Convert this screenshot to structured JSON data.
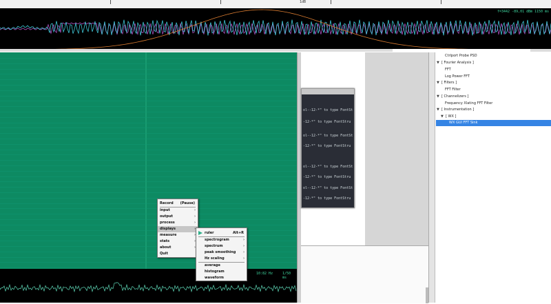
{
  "top_strip": {
    "marker_label": "1dB"
  },
  "scope": {
    "readout_left": "f=3442  -89,01 dBm",
    "readout_right": "1150 ms"
  },
  "spectrum": {
    "readout_left": "10:82 Hz",
    "readout_right": "1/50 ms"
  },
  "terminal": {
    "lines": [
      "ol--12-*\" to type FontSt",
      "-12-*\" to type FontStru",
      "ol--12-*\" to type FontSt",
      "-12-*\" to type FontStru",
      "ol--12-*\" to type FontSt",
      "-12-*\" to type FontStru",
      "ol--12-*\" to type FontSt",
      "-12-*\" to type FontStru"
    ]
  },
  "tree": {
    "items": [
      {
        "label": "Ctrlport Probe PSD",
        "arrow": ""
      },
      {
        "label": "[ Fourier Analysis ]",
        "arrow": "▼"
      },
      {
        "label": "FFT",
        "arrow": ""
      },
      {
        "label": "Log Power FFT",
        "arrow": ""
      },
      {
        "label": "[ Filters ]",
        "arrow": "▼"
      },
      {
        "label": "FFT Filter",
        "arrow": ""
      },
      {
        "label": "[ Channelizers ]",
        "arrow": "▼"
      },
      {
        "label": "Frequency Xlating FFT Filter",
        "arrow": ""
      },
      {
        "label": "[ Instrumentation ]",
        "arrow": "▼"
      },
      {
        "label": "[ WX ]",
        "arrow": "▼"
      },
      {
        "label": "WX GUI FFT Sink",
        "arrow": ""
      }
    ]
  },
  "main_menu": {
    "record_label": "Record",
    "record_shortcut": "(Pause)",
    "items": [
      "input",
      "output",
      "process",
      "displays",
      "measure",
      "stats",
      "about",
      "Quit"
    ],
    "arrow": "›"
  },
  "displays_menu": {
    "ruler_label": "ruler",
    "ruler_shortcut": "Alt+R",
    "items": [
      "spectrogram",
      "spectrum",
      "peak smoothing",
      "Hz scaling"
    ],
    "items2": [
      "average",
      "histogram",
      "waveform"
    ],
    "arrow": "›"
  },
  "colors": {
    "waterfall": "#0d8a62",
    "scope_trace": "#40c8d8",
    "scope_trace2": "#b050c0",
    "scope_curve": "#d97b30",
    "spectrum_trace": "#5fd9b8",
    "selection": "#3584e4"
  }
}
